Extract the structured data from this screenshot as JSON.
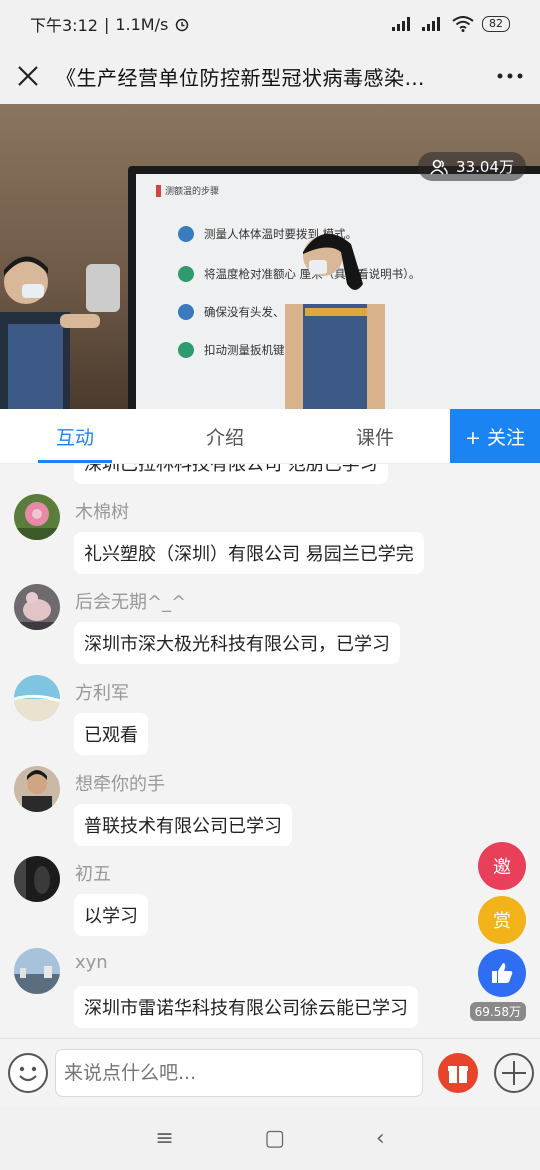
{
  "status_bar": {
    "time": "下午3:12",
    "speed": "1.1M/s",
    "battery": "82"
  },
  "header": {
    "title": "《生产经营单位防控新型冠状病毒感染…",
    "close_icon": "close-icon",
    "more_icon": "more-icon"
  },
  "video": {
    "viewer_count": "33.04万",
    "slide_title": "测额温的步骤",
    "slide_lines": [
      "测量人体体温时要拨到      模式。",
      "将温度枪对准额心                厘米（具体看说明书）。",
      "确保没有头发、汗水、",
      "扣动测量扳机键                    声蜂鸣，测量完毕。"
    ],
    "dot_colors": [
      "#3a7bbf",
      "#2e9b6d",
      "#3a7bbf",
      "#2e9b6d"
    ]
  },
  "tabs": {
    "items": [
      "互动",
      "介绍",
      "课件"
    ],
    "active": "互动",
    "follow_label": "+ 关注",
    "accent": "#1a84f3"
  },
  "chat": {
    "partial_bubble": "深圳巴拉林科技有限公司 范朋已学习",
    "messages": [
      {
        "name": "木棉树",
        "text": "礼兴塑胶（深圳）有限公司 易园兰已学完"
      },
      {
        "name": "后会无期^_^",
        "text": "深圳市深大极光科技有限公司，已学习"
      },
      {
        "name": "方利军",
        "text": "已观看"
      },
      {
        "name": "想牵你的手",
        "text": "普联技术有限公司已学习"
      },
      {
        "name": "初五",
        "text": "以学习"
      },
      {
        "name": "xyn",
        "text": "深圳市雷诺华科技有限公司徐云能已学习"
      }
    ]
  },
  "floating": {
    "invite_label": "邀",
    "reward_label": "赏",
    "like_count": "69.58万"
  },
  "input": {
    "placeholder": "来说点什么吧..."
  },
  "nav": {
    "menu_icon": "≡",
    "home_icon": "▢",
    "back_icon": "‹"
  }
}
